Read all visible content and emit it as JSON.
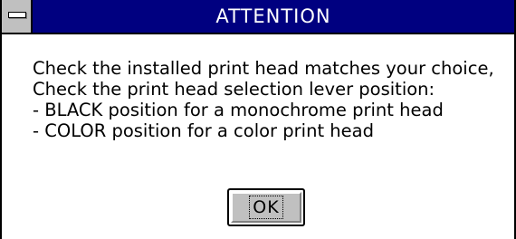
{
  "window": {
    "title": "ATTENTION",
    "system_menu_icon": "system-menu-bar"
  },
  "message": {
    "lines": [
      "Check the installed print head matches your choice,",
      "Check the print head selection lever position:",
      "- BLACK position for a monochrome print head",
      "- COLOR position for a color print head"
    ]
  },
  "buttons": {
    "ok_label": "OK"
  },
  "colors": {
    "titlebar": "#000080",
    "title_text": "#ffffff",
    "button_face": "#c0c0c0",
    "background": "#ffffff"
  }
}
